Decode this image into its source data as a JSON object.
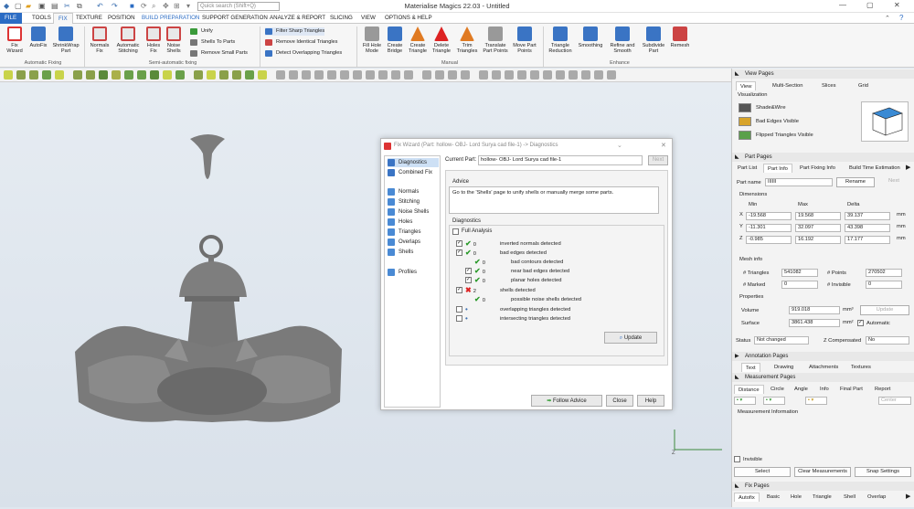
{
  "app": {
    "title": "Materialise Magics 22.03 - Untitled",
    "search_placeholder": "Quick search (Shift+Q)"
  },
  "menu": [
    "FILE",
    "TOOLS",
    "FIX",
    "TEXTURE",
    "POSITION",
    "BUILD PREPARATION",
    "SUPPORT GENERATION",
    "ANALYZE & REPORT",
    "SLICING",
    "VIEW",
    "OPTIONS & HELP"
  ],
  "ribbon": {
    "buttons": [
      {
        "label": "Fix\nWizard",
        "color": "#d33"
      },
      {
        "label": "AutoFix",
        "color": "#3a74c4"
      },
      {
        "label": "ShrinkWrap\nPart",
        "color": "#3a74c4"
      },
      {
        "label": "Normals\nFix",
        "color": "#c44"
      },
      {
        "label": "Automatic\nStitching",
        "color": "#c44"
      },
      {
        "label": "Holes\nFix",
        "color": "#c44"
      },
      {
        "label": "Noise\nShells",
        "color": "#c44"
      },
      {
        "label": "Fill Hole\nMode",
        "color": "#777"
      },
      {
        "label": "Create\nBridge",
        "color": "#3a74c4"
      },
      {
        "label": "Create\nTriangle",
        "color": "#e07a22"
      },
      {
        "label": "Delete\nTriangle",
        "color": "#d22"
      },
      {
        "label": "Trim\nTriangles",
        "color": "#e07a22"
      },
      {
        "label": "Translate\nPart Points",
        "color": "#777"
      },
      {
        "label": "Move Part\nPoints",
        "color": "#3a74c4"
      },
      {
        "label": "Triangle\nReduction",
        "color": "#3a74c4"
      },
      {
        "label": "Smoothing",
        "color": "#3a74c4"
      },
      {
        "label": "Refine and\nSmooth",
        "color": "#3a74c4"
      },
      {
        "label": "Subdivide\nPart",
        "color": "#3a74c4"
      },
      {
        "label": "Remesh",
        "color": "#c44"
      }
    ],
    "small": [
      "Unify",
      "Shells To Parts",
      "Remove Small Parts",
      "Filter Sharp Triangles",
      "Remove Identical Triangles",
      "Detect Overlapping Triangles"
    ],
    "groups": [
      "Automatic Fixing",
      "Semi-automatic fixing",
      "Manual",
      "Enhance"
    ]
  },
  "dialog": {
    "title": "Fix Wizard (Part: hollow- OBJ- Lord Surya cad file-1) -> Diagnostics",
    "nav": [
      "Diagnostics",
      "Combined Fix",
      "Normals",
      "Stitching",
      "Noise Shells",
      "Holes",
      "Triangles",
      "Overlaps",
      "Shells",
      "Profiles"
    ],
    "current_part_label": "Current Part:",
    "current_part_value": "hollow- OBJ- Lord Surya cad file-1",
    "next_label": "Next",
    "advice_title": "Advice",
    "advice_text": "Go to the 'Shells' page to unify shells or manually merge some parts.",
    "diagnostics_title": "Diagnostics",
    "full_analysis": "Full Analysis",
    "rows": [
      {
        "num": "0",
        "label": "inverted normals detected",
        "status": "ok",
        "checked": true
      },
      {
        "num": "0",
        "label": "bad edges detected",
        "status": "ok",
        "checked": true
      },
      {
        "num": "0",
        "label": "bad contours detected",
        "status": "ok",
        "checked": null
      },
      {
        "num": "0",
        "label": "near bad edges detected",
        "status": "ok",
        "checked": true
      },
      {
        "num": "0",
        "label": "planar holes detected",
        "status": "ok",
        "checked": true
      },
      {
        "num": "2",
        "label": "shells detected",
        "status": "bad",
        "checked": true
      },
      {
        "num": "0",
        "label": "possible noise shells detected",
        "status": "ok",
        "checked": null
      },
      {
        "num": "",
        "label": "overlapping triangles detected",
        "status": "dot",
        "checked": false
      },
      {
        "num": "",
        "label": "intersecting triangles detected",
        "status": "dot",
        "checked": false
      }
    ],
    "update": "Update",
    "follow": "Follow Advice",
    "close": "Close",
    "help": "Help"
  },
  "right": {
    "view_pages": "View Pages",
    "view_tabs": [
      "View",
      "Multi-Section",
      "Slices",
      "Grid"
    ],
    "visualization": "Visualization",
    "vis_items": [
      "Shade&Wire",
      "Bad Edges Visible",
      "Flipped Triangles Visible"
    ],
    "part_pages": "Part Pages",
    "part_tabs": [
      "Part List",
      "Part Info",
      "Part Fixing Info",
      "Build Time Estimation"
    ],
    "part_name_label": "Part name",
    "part_name_value": "IIIIII",
    "rename": "Rename",
    "next": "Next",
    "dimensions": "Dimensions",
    "dim_cols": [
      "Min",
      "Max",
      "Delta"
    ],
    "dims": [
      {
        "axis": "X",
        "min": "-19.568",
        "max": "19.568",
        "delta": "39.137",
        "unit": "mm"
      },
      {
        "axis": "Y",
        "min": "-11.301",
        "max": "32.097",
        "delta": "43.398",
        "unit": "mm"
      },
      {
        "axis": "Z",
        "min": "-0.985",
        "max": "16.192",
        "delta": "17.177",
        "unit": "mm"
      }
    ],
    "mesh_info": "Mesh info",
    "triangles_label": "# Triangles",
    "triangles": "541082",
    "points_label": "# Points",
    "points": "270502",
    "marked_label": "# Marked",
    "marked": "0",
    "invisible_label": "# Invisible",
    "invisible": "0",
    "properties": "Properties",
    "volume_label": "Volume",
    "volume": "919.018",
    "volume_unit": "mm³",
    "update": "Update",
    "surface_label": "Surface",
    "surface": "3861.438",
    "surface_unit": "mm²",
    "automatic": "Automatic",
    "status_label": "Status",
    "status_value": "Not changed",
    "zcomp_label": "Z Compensated",
    "zcomp_value": "No",
    "annotation_pages": "Annotation Pages",
    "ann_tabs": [
      "Text",
      "Drawing",
      "Attachments",
      "Textures"
    ],
    "measurement_pages": "Measurement Pages",
    "meas_tabs": [
      "Distance",
      "Circle",
      "Angle",
      "Info",
      "Final Part",
      "Report"
    ],
    "center": "Center",
    "measurement_info": "Measurement Information",
    "invisible_chk": "Invisible",
    "select": "Select",
    "clear": "Clear Measurements",
    "snap": "Snap Settings",
    "fix_pages": "Fix Pages",
    "fix_tabs": [
      "Autofix",
      "Basic",
      "Hole",
      "Triangle",
      "Shell",
      "Overlap"
    ]
  },
  "axis_label": "Z"
}
